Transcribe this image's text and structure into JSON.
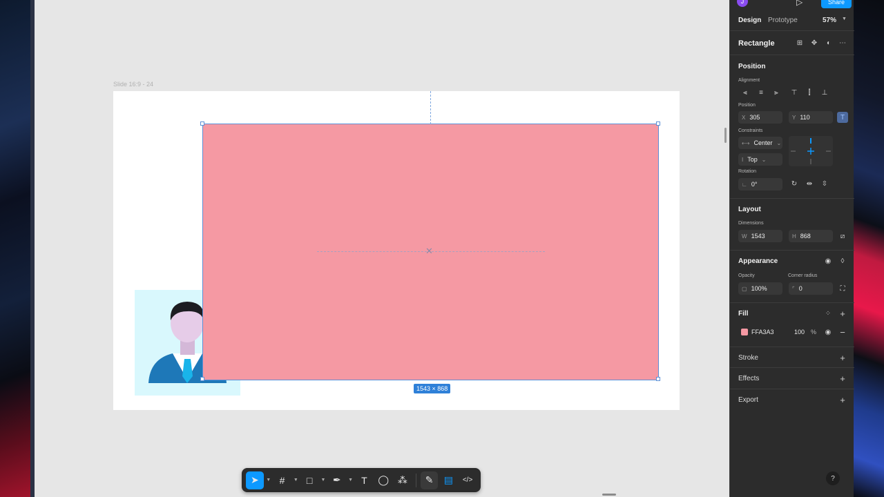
{
  "frame": {
    "label": "Slide 16:9 - 24"
  },
  "selection": {
    "size_badge": "1543 × 868"
  },
  "toolbar": {
    "tools": [
      {
        "name": "move-tool",
        "glyph": "➤"
      },
      {
        "name": "frame-tool",
        "glyph": "#"
      },
      {
        "name": "rectangle-tool",
        "glyph": "□"
      },
      {
        "name": "pen-tool",
        "glyph": "✒"
      },
      {
        "name": "text-tool",
        "glyph": "T"
      },
      {
        "name": "comment-tool",
        "glyph": "◯"
      },
      {
        "name": "actions-tool",
        "glyph": "⁂"
      },
      {
        "name": "draw-mode",
        "glyph": "✎"
      },
      {
        "name": "design-mode",
        "glyph": "▤"
      },
      {
        "name": "dev-mode",
        "glyph": "</>"
      }
    ]
  },
  "panel": {
    "user_initial": "J",
    "share_label": "Share",
    "tabs": {
      "design": "Design",
      "prototype": "Prototype"
    },
    "zoom": "57%",
    "layer_name": "Rectangle",
    "position": {
      "title": "Position",
      "alignment_label": "Alignment",
      "position_label": "Position",
      "x_prefix": "X",
      "x": "305",
      "y_prefix": "Y",
      "y": "110",
      "constraints_label": "Constraints",
      "constraint_h": "Center",
      "constraint_v": "Top",
      "rotation_label": "Rotation",
      "rotation": "0°"
    },
    "layout": {
      "title": "Layout",
      "dimensions_label": "Dimensions",
      "w_prefix": "W",
      "w": "1543",
      "h_prefix": "H",
      "h": "868"
    },
    "appearance": {
      "title": "Appearance",
      "opacity_label": "Opacity",
      "opacity": "100%",
      "corner_radius_label": "Corner radius",
      "corner_radius": "0"
    },
    "fill": {
      "title": "Fill",
      "color_hex": "FFA3A3",
      "swatch_color": "#f599a3",
      "opacity": "100",
      "unit": "%"
    },
    "stroke_title": "Stroke",
    "effects_title": "Effects",
    "export_title": "Export",
    "help": "?"
  },
  "colors": {
    "accent": "#0d99ff",
    "rect_fill": "#f599a3",
    "avatar_bg": "#d9f8fd"
  }
}
